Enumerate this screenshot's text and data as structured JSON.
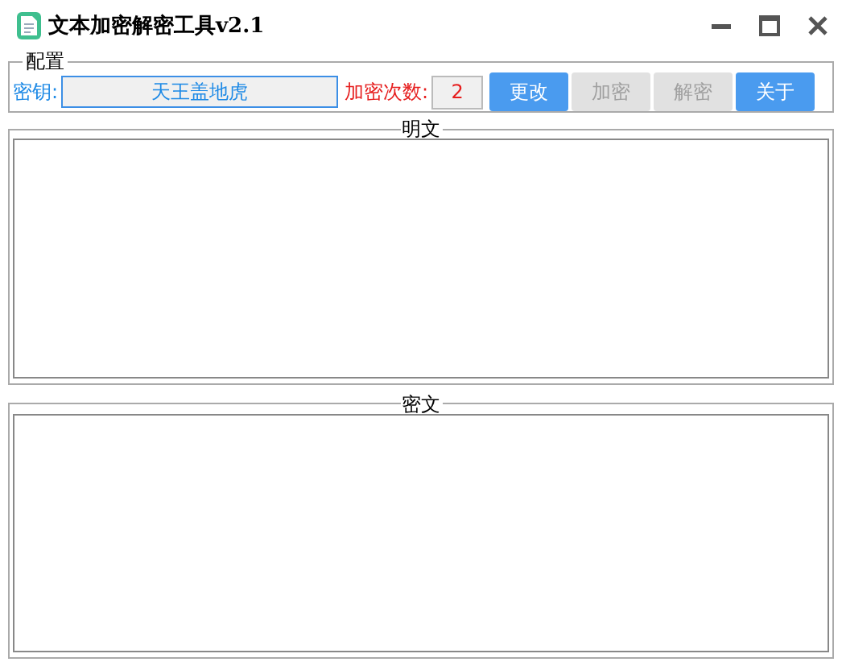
{
  "window": {
    "title": "文本加密解密工具v2.1"
  },
  "config": {
    "legend": "配置",
    "key_label": "密钥:",
    "key_value": "天王盖地虎",
    "count_label": "加密次数:",
    "count_value": "2",
    "buttons": [
      {
        "label": "更改",
        "disabled": false
      },
      {
        "label": "加密",
        "disabled": true
      },
      {
        "label": "解密",
        "disabled": true
      },
      {
        "label": "关于",
        "disabled": false
      }
    ]
  },
  "plaintext": {
    "legend": "明文"
  },
  "ciphertext": {
    "legend": "密文"
  }
}
